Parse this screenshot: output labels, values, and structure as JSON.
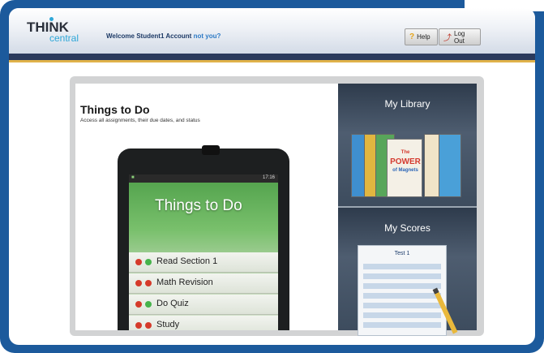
{
  "header": {
    "logo_top": "THINK",
    "logo_bottom": "central",
    "welcome_text": "Welcome Student1 Account",
    "not_you_link": "not you?",
    "help_label": "Help",
    "logout_label": "Log Out"
  },
  "main": {
    "todo": {
      "title": "Things to Do",
      "subtitle": "Access all assignments, their due dates, and status",
      "screen_title": "Things to Do",
      "status_time": "17:16",
      "tasks": [
        {
          "label": "Read Section 1"
        },
        {
          "label": "Math Revision"
        },
        {
          "label": "Do Quiz"
        },
        {
          "label": "Study"
        }
      ]
    },
    "library": {
      "title": "My Library",
      "book_line1": "The",
      "book_line2": "POWER",
      "book_line3": "of Magnets"
    },
    "scores": {
      "title": "My Scores",
      "sheet_title": "Test 1"
    }
  },
  "colors": {
    "frame_blue": "#1c5a9c",
    "header_navy": "#2a3a5c",
    "gold_rule": "#e0b24a",
    "panel_slate": "#3d4c5e",
    "logo_accent": "#2ea7d8"
  }
}
